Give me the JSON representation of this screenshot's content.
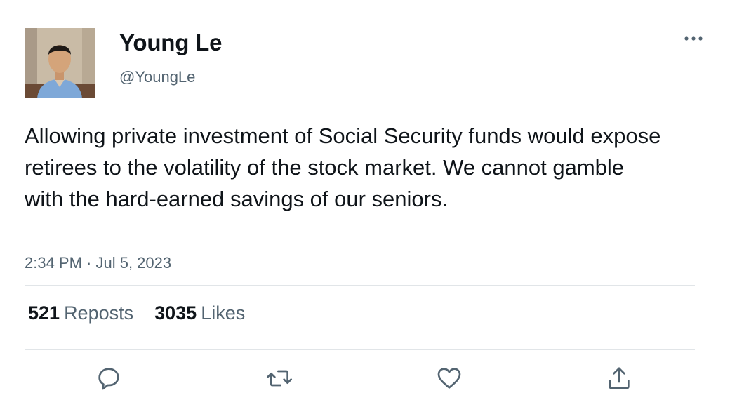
{
  "author": {
    "name": "Young Le",
    "handle": "@YoungLe",
    "avatar_icon": "profile-photo"
  },
  "tweet": {
    "text": "Allowing private investment of Social Security funds would expose retirees to the volatility of the stock market. We cannot gamble with the hard-earned savings of our seniors.",
    "timestamp": "2:34 PM · Jul 5, 2023"
  },
  "stats": {
    "reposts_count": "521",
    "reposts_label": "Reposts",
    "likes_count": "3035",
    "likes_label": "Likes"
  },
  "actions": {
    "reply_icon": "reply-icon",
    "repost_icon": "repost-icon",
    "like_icon": "heart-icon",
    "share_icon": "share-icon"
  },
  "colors": {
    "text_primary": "#0f1419",
    "text_secondary": "#536471",
    "divider": "#e1e5e8",
    "icon": "#536471"
  }
}
